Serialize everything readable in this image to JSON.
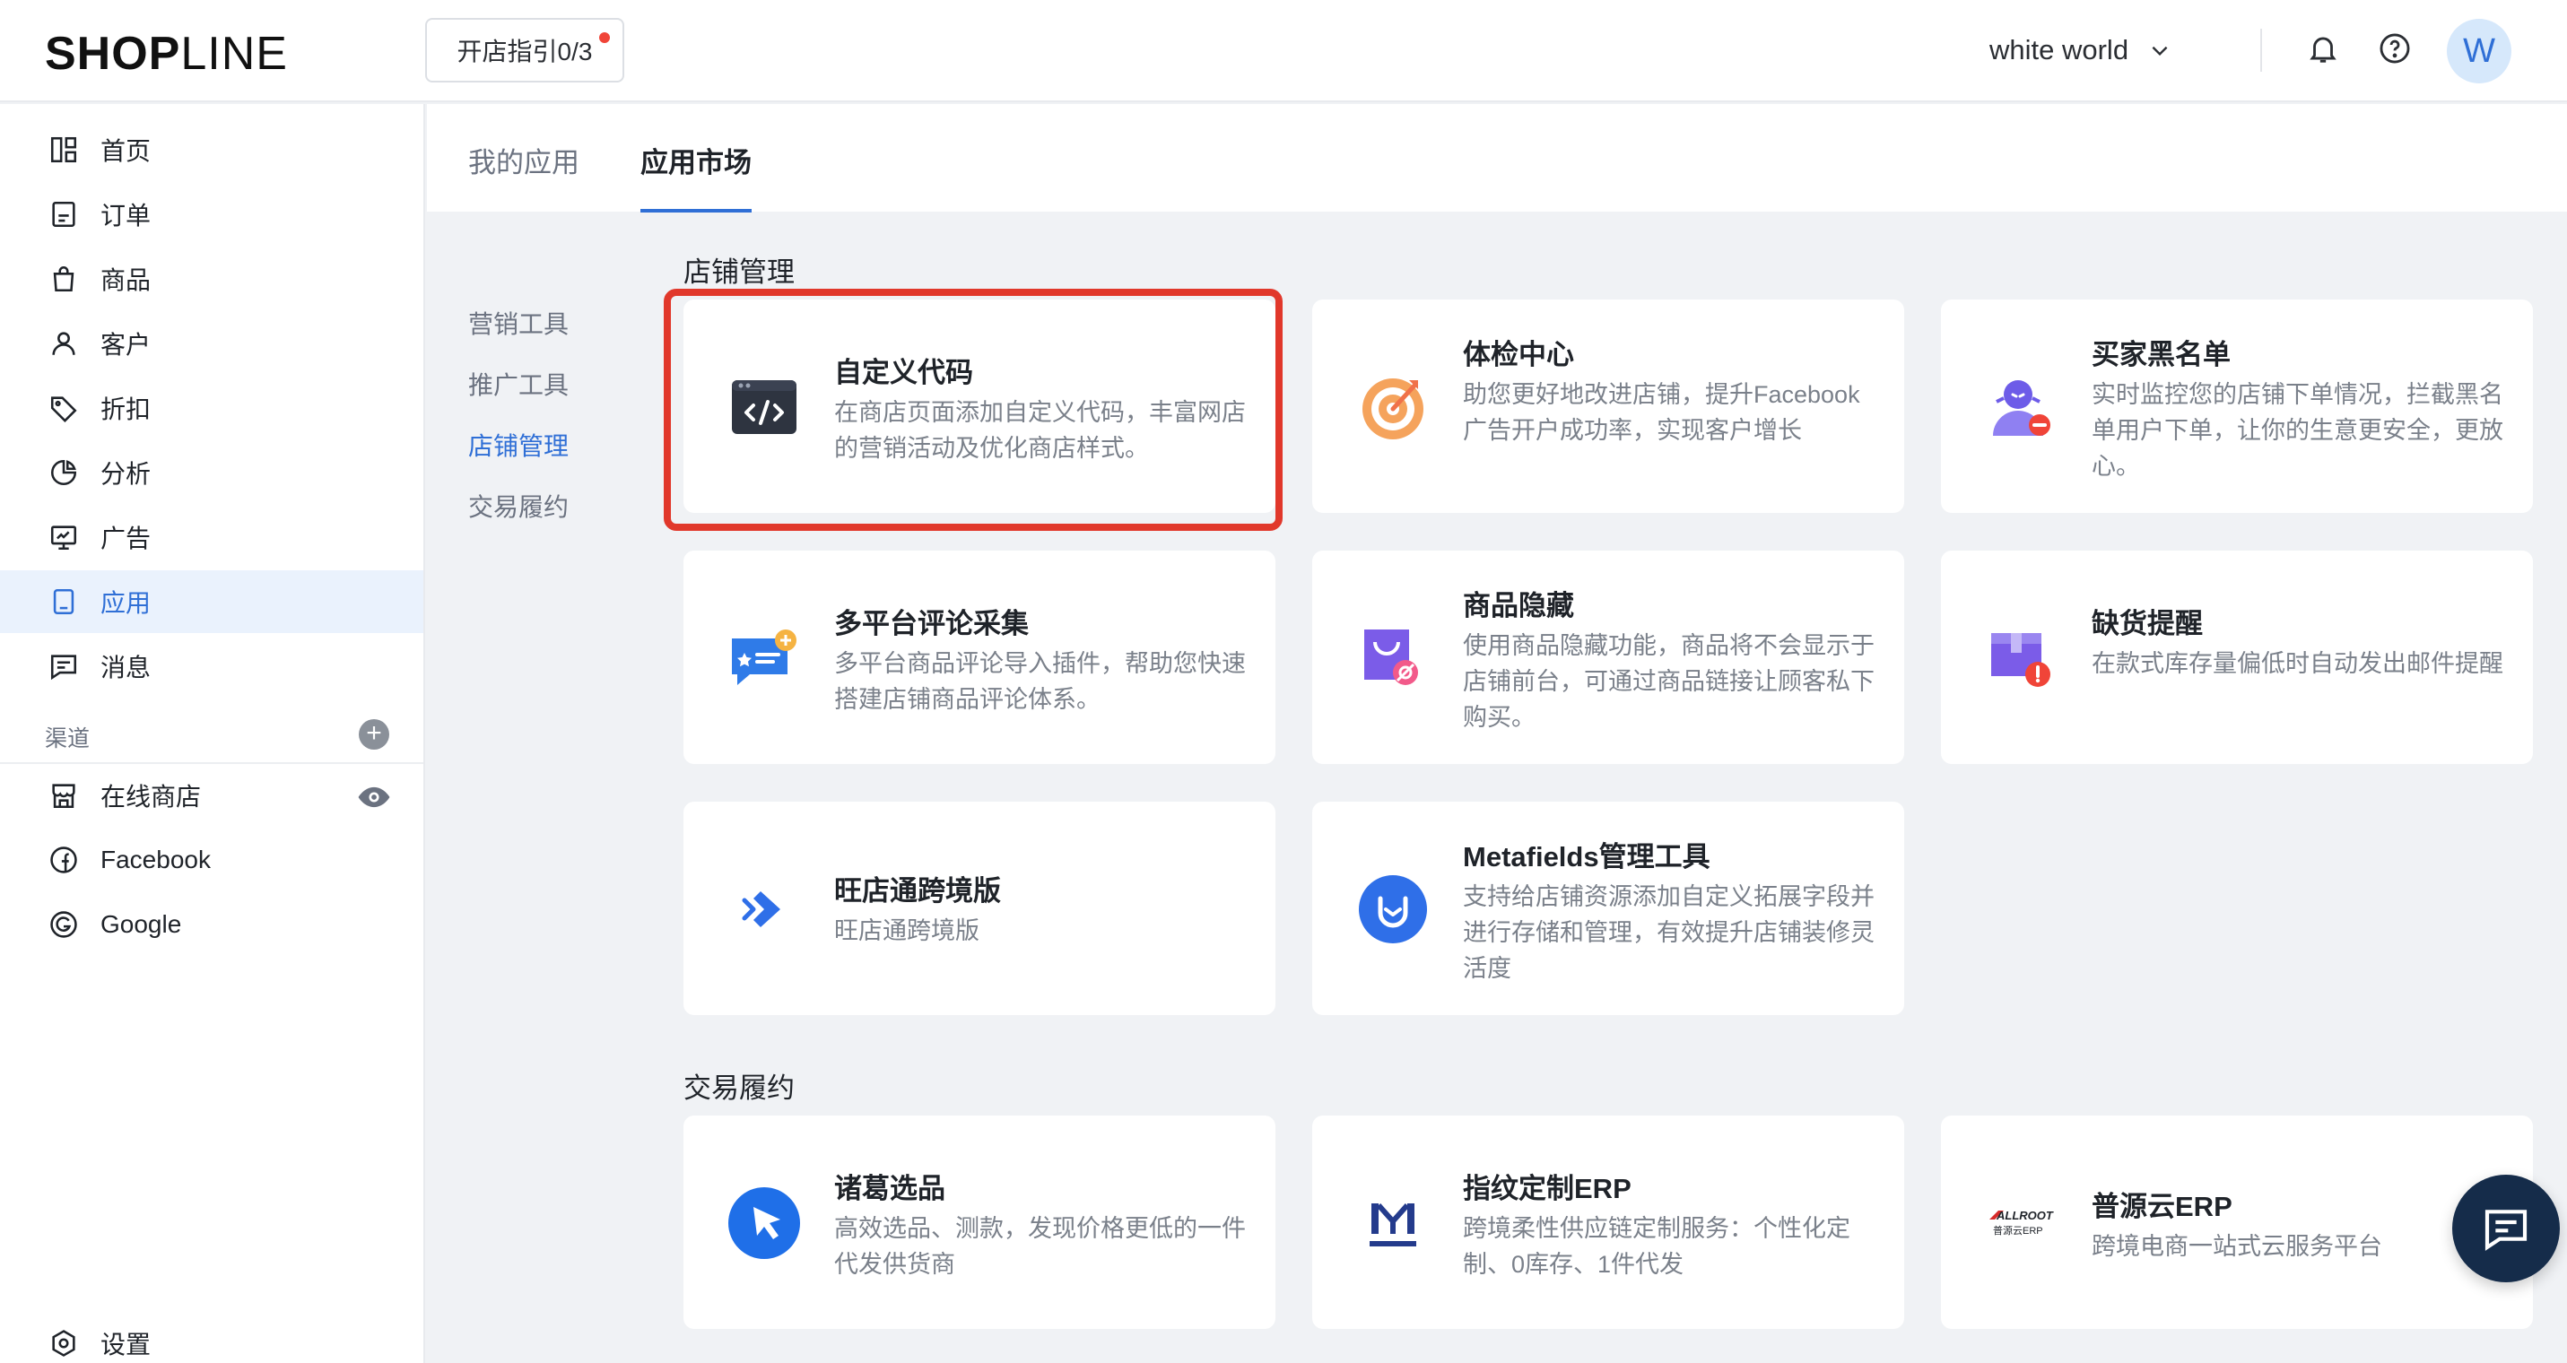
{
  "header": {
    "logo_bold": "SHOP",
    "logo_light": "LINE",
    "guide_button": "开店指引0/3",
    "store_name": "white world",
    "avatar_letter": "W"
  },
  "sidebar": {
    "items": [
      {
        "label": "首页",
        "icon": "dashboard-icon"
      },
      {
        "label": "订单",
        "icon": "order-icon"
      },
      {
        "label": "商品",
        "icon": "bag-icon"
      },
      {
        "label": "客户",
        "icon": "user-icon"
      },
      {
        "label": "折扣",
        "icon": "tag-icon"
      },
      {
        "label": "分析",
        "icon": "pie-chart-icon"
      },
      {
        "label": "广告",
        "icon": "monitor-icon"
      },
      {
        "label": "应用",
        "icon": "app-icon"
      },
      {
        "label": "消息",
        "icon": "message-icon"
      }
    ],
    "channel_label": "渠道",
    "channels": [
      {
        "label": "在线商店",
        "icon": "store-icon"
      },
      {
        "label": "Facebook",
        "icon": "facebook-icon"
      },
      {
        "label": "Google",
        "icon": "google-icon"
      }
    ],
    "settings": "设置"
  },
  "tabs": [
    "我的应用",
    "应用市场"
  ],
  "subnav": [
    "营销工具",
    "推广工具",
    "店铺管理",
    "交易履约"
  ],
  "sections": {
    "store_management": "店铺管理",
    "fulfillment": "交易履约"
  },
  "cards": [
    {
      "title": "自定义代码",
      "desc": "在商店页面添加自定义代码，丰富网店的营销活动及优化商店样式。",
      "icon": "code-icon"
    },
    {
      "title": "体检中心",
      "desc": "助您更好地改进店铺，提升Facebook广告开户成功率，实现客户增长",
      "icon": "target-icon"
    },
    {
      "title": "买家黑名单",
      "desc": "实时监控您的店铺下单情况，拦截黑名单用户下单，让你的生意更安全，更放心。",
      "icon": "blacklist-user-icon"
    },
    {
      "title": "多平台评论采集",
      "desc": "多平台商品评论导入插件，帮助您快速搭建店铺商品评论体系。",
      "icon": "review-chat-icon"
    },
    {
      "title": "商品隐藏",
      "desc": "使用商品隐藏功能，商品将不会显示于店铺前台，可通过商品链接让顾客私下购买。",
      "icon": "hidden-bag-icon"
    },
    {
      "title": "缺货提醒",
      "desc": "在款式库存量偏低时自动发出邮件提醒",
      "icon": "stock-alert-icon"
    },
    {
      "title": "旺店通跨境版",
      "desc": "旺店通跨境版",
      "icon": "arrow-logo-icon"
    },
    {
      "title": "Metafields管理工具",
      "desc": "支持给店铺资源添加自定义拓展字段并进行存储和管理，有效提升店铺装修灵活度",
      "icon": "metafields-icon"
    },
    {
      "title": "诸葛选品",
      "desc": "高效选品、测款，发现价格更低的一件代发供货商",
      "icon": "cursor-logo-icon"
    },
    {
      "title": "指纹定制ERP",
      "desc": "跨境柔性供应链定制服务：个性化定制、0库存、1件代发",
      "icon": "custom-logo-icon"
    },
    {
      "title": "普源云ERP",
      "desc": "跨境电商一站式云服务平台",
      "icon": "allroot-logo-icon",
      "logo_text_top": "ALLROOT",
      "logo_text_bottom": "普源云ERP"
    }
  ],
  "colors": {
    "accent": "#2f6fd6",
    "highlight_border": "#e1382b",
    "notification_dot": "#f04438",
    "chat_button": "#152c4a"
  }
}
